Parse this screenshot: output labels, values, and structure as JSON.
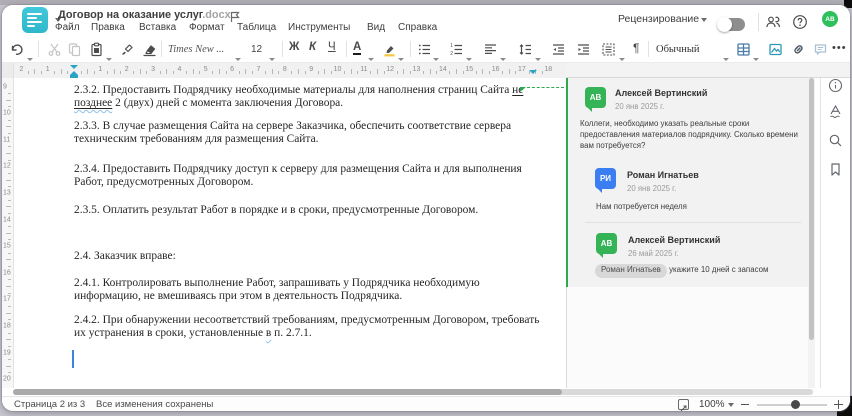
{
  "window": {
    "title": "Договор на оказание услуг",
    "title_extension": ".docx"
  },
  "menu": {
    "items": [
      "Файл",
      "Правка",
      "Вставка",
      "Формат",
      "Таблица",
      "Инструменты",
      "Вид",
      "Справка"
    ]
  },
  "header_right": {
    "review_label": "Рецензирование",
    "review_toggle_state": "off",
    "avatar_initials": "АВ"
  },
  "toolbar": {
    "font_name": "Times New ...",
    "font_size": "12",
    "bold_label": "Ж",
    "italic_label": "К",
    "underline_label": "Ч",
    "font_color_label": "А",
    "paragraph_mark": "¶",
    "style_name": "Обычный",
    "more_label": "•••"
  },
  "ruler": {
    "h_min": -2,
    "h_max": 18,
    "v_min": 9,
    "v_max": 20
  },
  "document": {
    "p1": {
      "l1a": "2.3.2. Предоставить Подрядчику необходимые материалы для наполнения страниц Сайта ",
      "l1b": "не",
      "l2a": "позднее",
      "l2b": " 2 (двух) дней с момента заключения Договора."
    },
    "p2": {
      "l1": "2.3.3. В случае размещения Сайта на сервере Заказчика, обеспечить соответствие сервера",
      "l2": "техническим требованиям для размещения Сайта."
    },
    "p3": {
      "l1": "2.3.4. Предоставить Подрядчику доступ к серверу для размещения Сайта и для выполнения",
      "l2": "Работ, предусмотренных Договором."
    },
    "p4": {
      "l1": "2.3.5. Оплатить результат Работ в порядке и в сроки, предусмотренные Договором."
    },
    "p5": {
      "l1": "2.4. Заказчик вправе:"
    },
    "p6": {
      "l1": "2.4.1. Контролировать выполнение Работ, запрашивать у Подрядчика необходимую",
      "l2": "информацию, не вмешиваясь при этом в деятельность Подрядчика."
    },
    "p7": {
      "l1": "2.4.2. При обнаружении несоответствий требованиям, предусмотренным Договором, требовать",
      "l2a": "их устранения в сроки, установленные ",
      "l2b": "в",
      "l2c": " п. 2.7.1."
    }
  },
  "comments": {
    "thread": [
      {
        "initials": "АВ",
        "name": "Алексей Вертинский",
        "date": "20 янв 2025 г.",
        "body": "Коллеги, необходимо указать реальные сроки\nпредоставления материалов подрядчику. Сколько времени\nвам потребуется?"
      },
      {
        "initials": "РИ",
        "name": "Роман Игнатьев",
        "date": "20 янв 2025 г.",
        "body": "Нам потребуется неделя"
      },
      {
        "initials": "АВ",
        "name": "Алексей Вертинский",
        "date": "26 май 2025 г.",
        "mention": "Роман Игнатьев",
        "body": " укажите 10 дней с запасом"
      }
    ]
  },
  "statusbar": {
    "page_indicator": "Страница 2 из 3",
    "save_status": "Все изменения сохранены",
    "zoom_value": "100%"
  },
  "colors": {
    "accent_teal": "#2aa4c4",
    "comment_green": "#2fa84f",
    "avatar_green": "#35b357",
    "avatar_blue": "#3b7ef2",
    "logo_teal": "#38c0d4"
  }
}
